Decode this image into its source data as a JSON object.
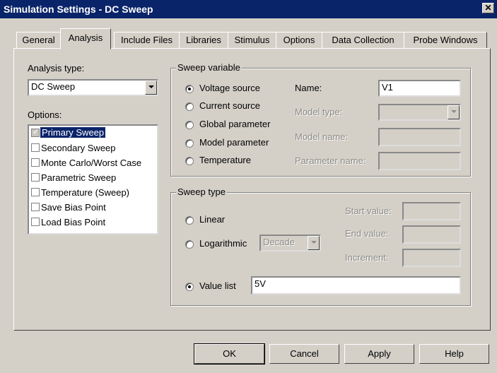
{
  "window": {
    "title": "Simulation Settings - DC Sweep",
    "close_glyph": "✕"
  },
  "tabs": [
    {
      "label": "General"
    },
    {
      "label": "Analysis"
    },
    {
      "label": "Include Files"
    },
    {
      "label": "Libraries"
    },
    {
      "label": "Stimulus"
    },
    {
      "label": "Options"
    },
    {
      "label": "Data Collection"
    },
    {
      "label": "Probe Windows"
    }
  ],
  "analysis_type": {
    "label": "Analysis type:",
    "value": "DC Sweep"
  },
  "options": {
    "label": "Options:",
    "items": [
      {
        "label": "Primary Sweep",
        "checked": true,
        "selected": true
      },
      {
        "label": "Secondary Sweep",
        "checked": false
      },
      {
        "label": "Monte Carlo/Worst Case",
        "checked": false
      },
      {
        "label": "Parametric Sweep",
        "checked": false
      },
      {
        "label": "Temperature (Sweep)",
        "checked": false
      },
      {
        "label": "Save Bias Point",
        "checked": false
      },
      {
        "label": "Load Bias Point",
        "checked": false
      }
    ]
  },
  "sweep_variable": {
    "title": "Sweep variable",
    "radios": [
      {
        "label": "Voltage source",
        "checked": true
      },
      {
        "label": "Current source",
        "checked": false
      },
      {
        "label": "Global parameter",
        "checked": false
      },
      {
        "label": "Model parameter",
        "checked": false
      },
      {
        "label": "Temperature",
        "checked": false
      }
    ],
    "name_label": "Name:",
    "name_value": "V1",
    "model_type_label": "Model type:",
    "model_name_label": "Model name:",
    "parameter_name_label": "Parameter name:"
  },
  "sweep_type": {
    "title": "Sweep type",
    "linear_label": "Linear",
    "logarithmic_label": "Logarithmic",
    "log_scale_value": "Decade",
    "start_label": "Start value:",
    "end_label": "End value:",
    "increment_label": "Increment:",
    "value_list_label": "Value list",
    "value_list_value": "5V",
    "selected": "value_list"
  },
  "buttons": {
    "ok": "OK",
    "cancel": "Cancel",
    "apply": "Apply",
    "help": "Help"
  },
  "colors": {
    "titlebar": "#0a246a",
    "face": "#d4d0c8",
    "selection": "#0a246a"
  }
}
